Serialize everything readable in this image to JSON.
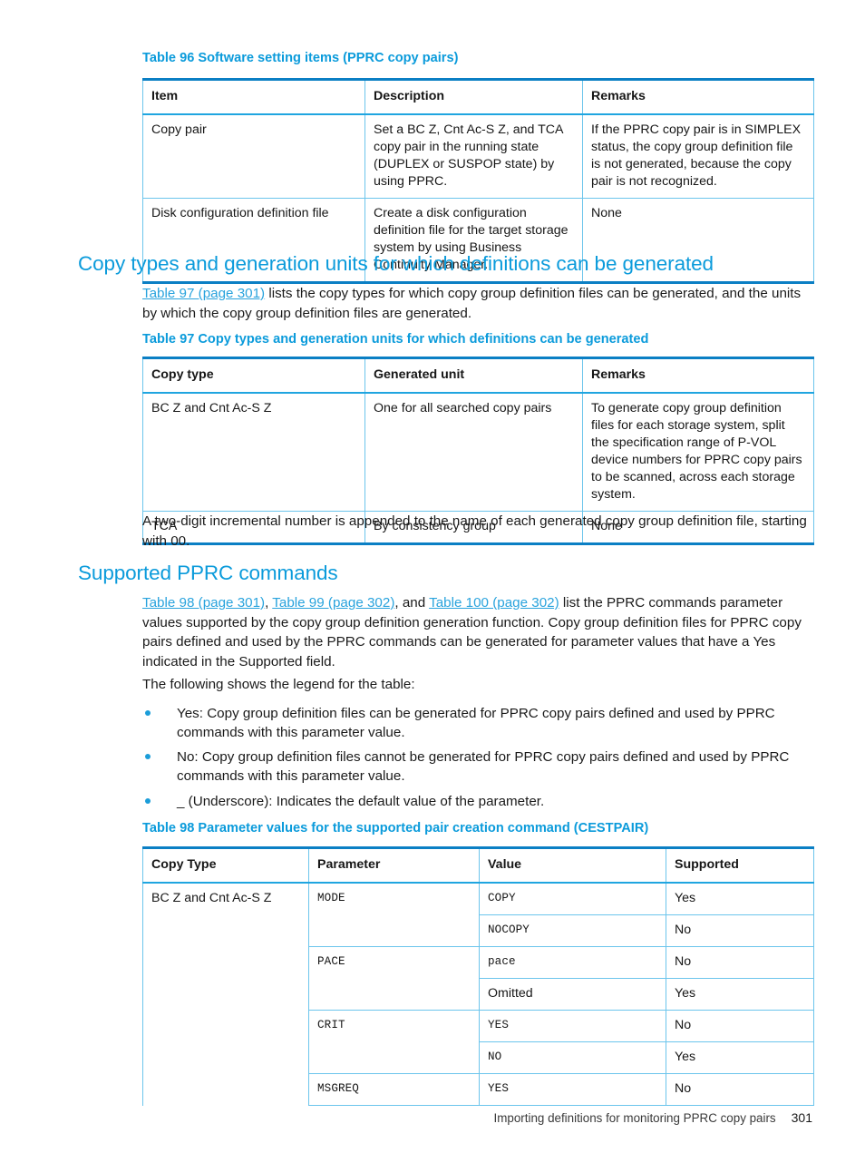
{
  "colors": {
    "heading_blue": "#0b9bdb",
    "link_blue": "#29a3dd",
    "table_rule_dark": "#0b7fc4",
    "table_rule_light": "#6cc5ec",
    "bullet_blue": "#1b9dd9"
  },
  "table96": {
    "caption": "Table 96 Software setting items (PPRC copy pairs)",
    "headers": [
      "Item",
      "Description",
      "Remarks"
    ],
    "rows": [
      {
        "item": "Copy pair",
        "description": "Set a BC Z, Cnt Ac-S Z, and TCA copy pair in the running state (DUPLEX or SUSPOP state) by using PPRC.",
        "remarks": "If the PPRC copy pair is in SIMPLEX status, the copy group definition file is not generated, because the copy pair is not recognized."
      },
      {
        "item": "Disk configuration definition file",
        "description": "Create a disk configuration definition file for the target storage system by using Business Continuity Manager.",
        "remarks": "None"
      }
    ]
  },
  "section1": {
    "heading": "Copy types and generation units for which definitions can be generated",
    "intro_link": "Table 97 (page 301)",
    "intro_rest": " lists the copy types for which copy group definition files can be generated, and the units by which the copy group definition files are generated."
  },
  "table97": {
    "caption": "Table 97 Copy types and generation units for which definitions can be generated",
    "headers": [
      "Copy type",
      "Generated unit",
      "Remarks"
    ],
    "rows": [
      {
        "copy_type": "BC Z and Cnt Ac-S Z",
        "generated_unit": "One for all searched copy pairs",
        "remarks": "To generate copy group definition files for each storage system, split the specification range of P-VOL device numbers for PPRC copy pairs to be scanned, across each storage system."
      },
      {
        "copy_type": "TCA",
        "generated_unit": "By consistency group",
        "remarks": "None"
      }
    ]
  },
  "after_table97_para": "A two-digit incremental number is appended to the name of each generated copy group definition file, starting with 00.",
  "section2": {
    "heading": "Supported PPRC commands",
    "para_link1": "Table 98 (page 301)",
    "para_sep1": ", ",
    "para_link2": "Table 99 (page 302)",
    "para_sep2": ", and ",
    "para_link3": "Table 100 (page 302)",
    "para_rest": " list the PPRC commands parameter values supported by the copy group definition generation function. Copy group definition files for PPRC copy pairs defined and used by the PPRC commands can be generated for parameter values that have a Yes indicated in the Supported field.",
    "legend_intro": "The following shows the legend for the table:",
    "bullets": [
      "Yes: Copy group definition files can be generated for PPRC copy pairs defined and used by PPRC commands with this parameter value.",
      "No: Copy group definition files cannot be generated for PPRC copy pairs defined and used by PPRC commands with this parameter value.",
      "_ (Underscore): Indicates the default value of the parameter."
    ]
  },
  "table98": {
    "caption": "Table 98 Parameter values for the supported pair creation command (CESTPAIR)",
    "headers": [
      "Copy Type",
      "Parameter",
      "Value",
      "Supported"
    ],
    "rows": [
      {
        "copy_type": "BC Z and Cnt Ac-S Z",
        "parameter": "MODE",
        "value": "COPY",
        "supported": "Yes"
      },
      {
        "copy_type": "",
        "parameter": "",
        "value": "NOCOPY",
        "supported": "No"
      },
      {
        "copy_type": "",
        "parameter": "PACE",
        "value": "pace",
        "supported": "No"
      },
      {
        "copy_type": "",
        "parameter": "",
        "value": "Omitted",
        "supported": "Yes"
      },
      {
        "copy_type": "",
        "parameter": "CRIT",
        "value": "YES",
        "supported": "No"
      },
      {
        "copy_type": "",
        "parameter": "",
        "value": "NO",
        "supported": "Yes"
      },
      {
        "copy_type": "",
        "parameter": "MSGREQ",
        "value": "YES",
        "supported": "No"
      }
    ]
  },
  "footer": {
    "text": "Importing definitions for monitoring PPRC copy pairs",
    "page_number": "301"
  }
}
